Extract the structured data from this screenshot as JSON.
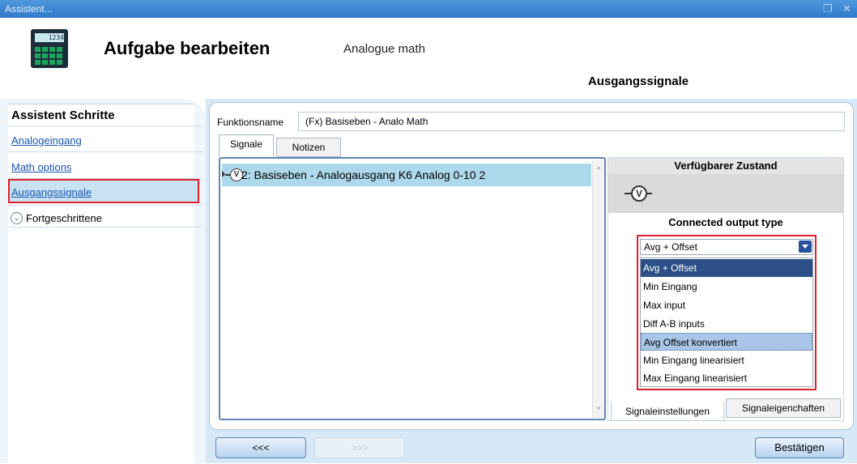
{
  "window": {
    "title": "Assistent...",
    "restore_glyph": "❐",
    "close_glyph": "✕"
  },
  "header": {
    "icon_screen": "1234",
    "title": "Aufgabe bearbeiten",
    "subtitle": "Analogue math",
    "active_tab": "Ausgangssignale"
  },
  "steps": {
    "title": "Assistent Schritte",
    "items": [
      {
        "label": "Analogeingang"
      },
      {
        "label": "Math options"
      },
      {
        "label": "Ausgangssignale"
      }
    ],
    "advanced_label": "Fortgeschrittene"
  },
  "main": {
    "function_label": "Funktionsname",
    "function_value": "(Fx) Basiseben - Analo Math",
    "tabs": [
      {
        "label": "Signale"
      },
      {
        "label": "Notizen"
      }
    ],
    "signals": [
      {
        "icon": "V",
        "label": "2: Basiseben - Analogausgang K6 Analog 0-10 2"
      }
    ]
  },
  "state_panel": {
    "title": "Verfügbarer Zustand",
    "icon": "V",
    "output_type_title": "Connected output type",
    "selected": "Avg + Offset",
    "options": [
      "Avg + Offset",
      "Min Eingang",
      "Max input",
      "Diff A-B inputs",
      "Avg Offset konvertiert",
      "Min Eingang linearisiert",
      "Max Eingang linearisiert"
    ],
    "subtabs": {
      "settings": "Signaleinstellungen",
      "properties": "Signaleigenchaften"
    }
  },
  "footer": {
    "back": "<<<",
    "next": ">>>",
    "confirm": "Bestätigen"
  }
}
